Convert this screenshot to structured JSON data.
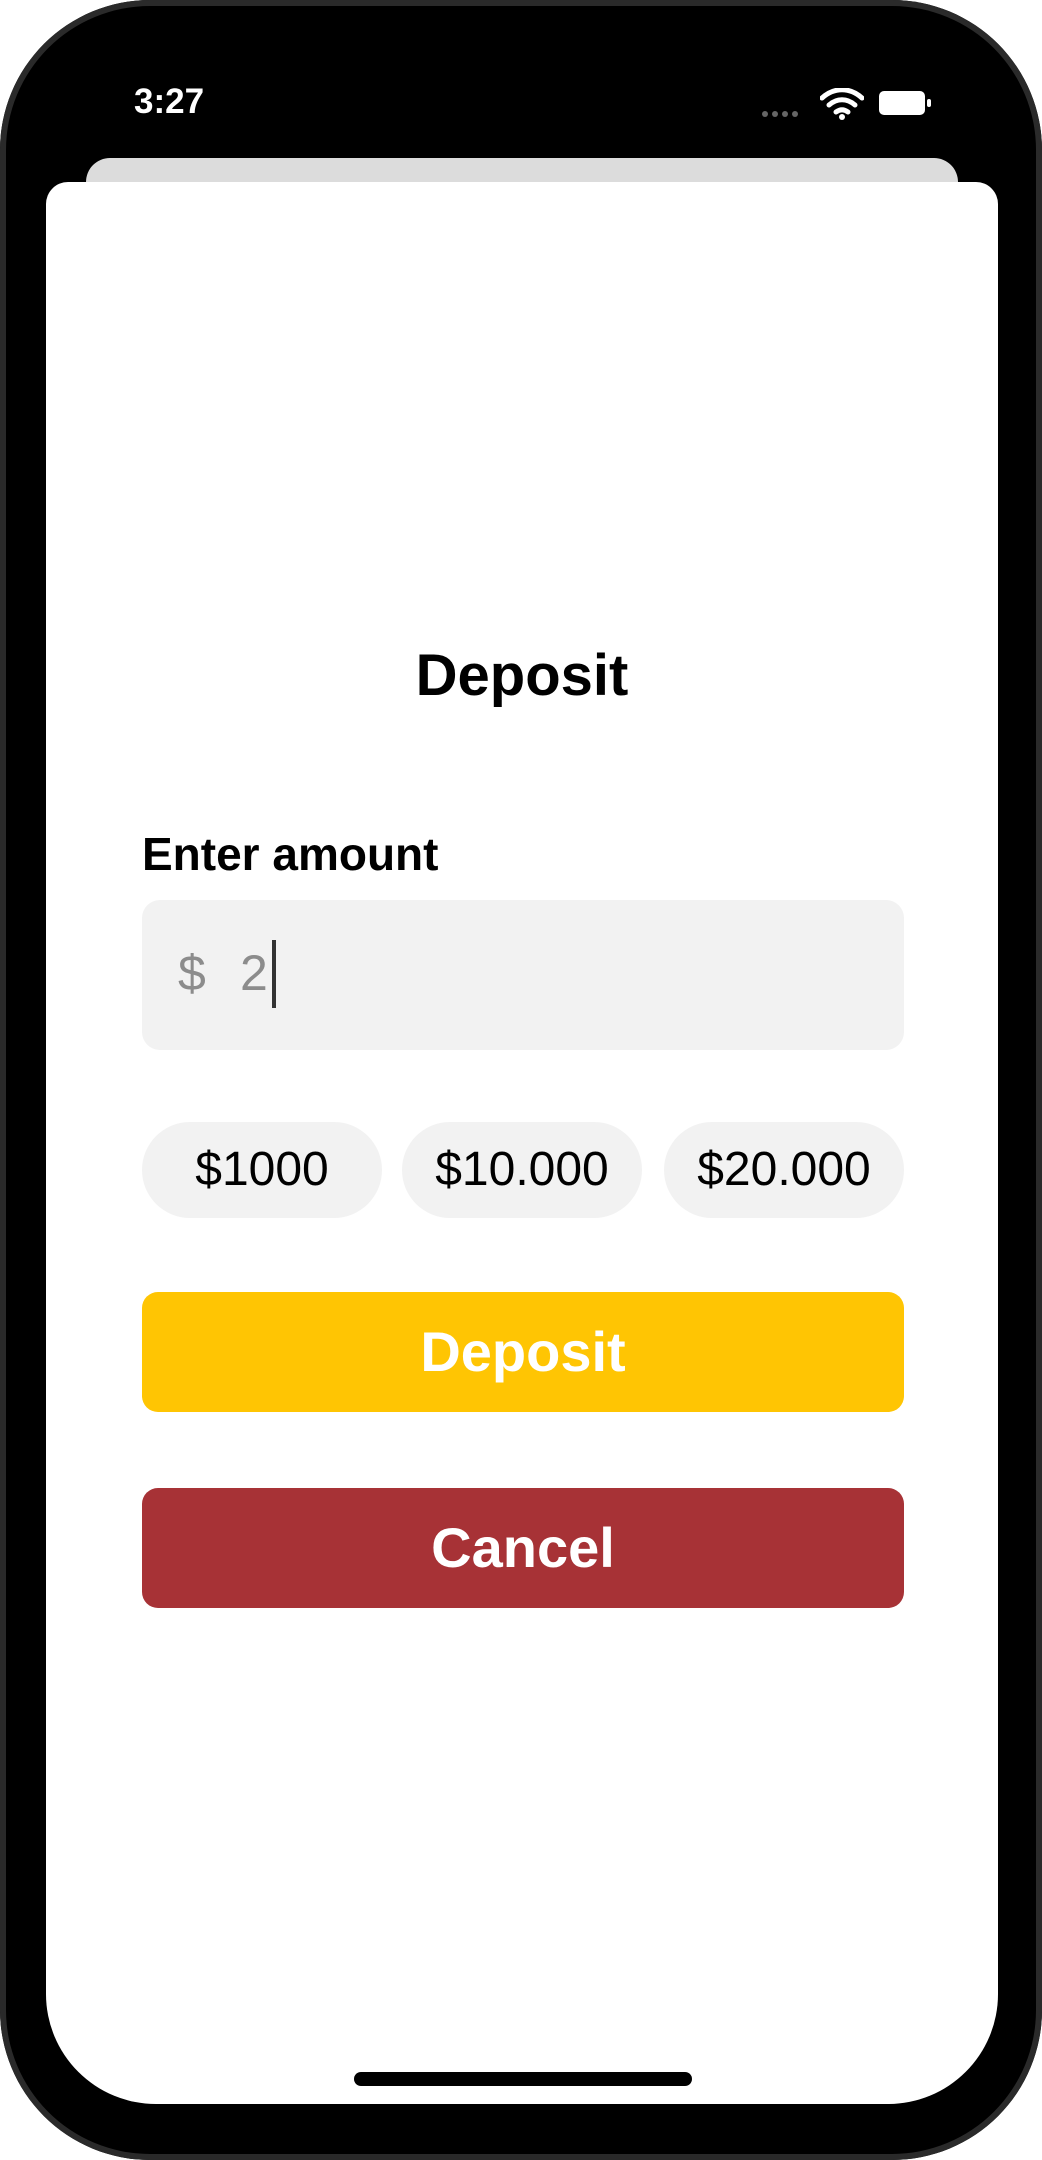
{
  "status_bar": {
    "time": "3:27",
    "wifi_icon": "wifi-icon",
    "battery_icon": "battery-icon"
  },
  "deposit_sheet": {
    "title": "Deposit",
    "amount_label": "Enter amount",
    "currency_symbol": "$",
    "amount_value": "2",
    "quick_amounts": [
      "$1000",
      "$10.000",
      "$20.000"
    ],
    "deposit_label": "Deposit",
    "cancel_label": "Cancel"
  },
  "colors": {
    "deposit": "#ffc503",
    "cancel": "#a73236",
    "input_background": "#f2f2f2"
  }
}
